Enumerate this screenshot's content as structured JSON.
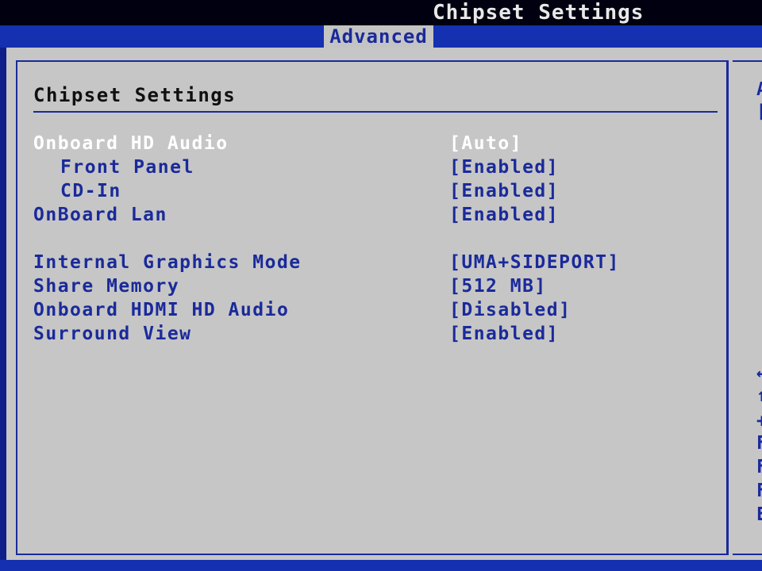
{
  "header": {
    "title": "Chipset Settings"
  },
  "menu": {
    "active_tab": "Advanced"
  },
  "panel": {
    "title": "Chipset Settings",
    "settings": [
      {
        "label": "Onboard HD Audio",
        "value": "[Auto]"
      },
      {
        "label": "Front Panel",
        "value": "[Enabled]"
      },
      {
        "label": "CD-In",
        "value": "[Enabled]"
      },
      {
        "label": "OnBoard Lan",
        "value": "[Enabled]"
      },
      {
        "label": "Internal Graphics Mode",
        "value": "[UMA+SIDEPORT]"
      },
      {
        "label": "Share Memory",
        "value": "[512 MB]"
      },
      {
        "label": "Onboard HDMI HD Audio",
        "value": "[Disabled]"
      },
      {
        "label": "Surround View",
        "value": "[Enabled]"
      }
    ]
  },
  "help": {
    "top_chars": [
      "A",
      "["
    ],
    "key_chars": [
      "←",
      "↑",
      "+",
      "F",
      "F",
      "F",
      "E"
    ]
  },
  "colors": {
    "bios_blue": "#1a2a9a",
    "background_gray": "#c6c6c6",
    "highlight_white": "#ffffff"
  }
}
